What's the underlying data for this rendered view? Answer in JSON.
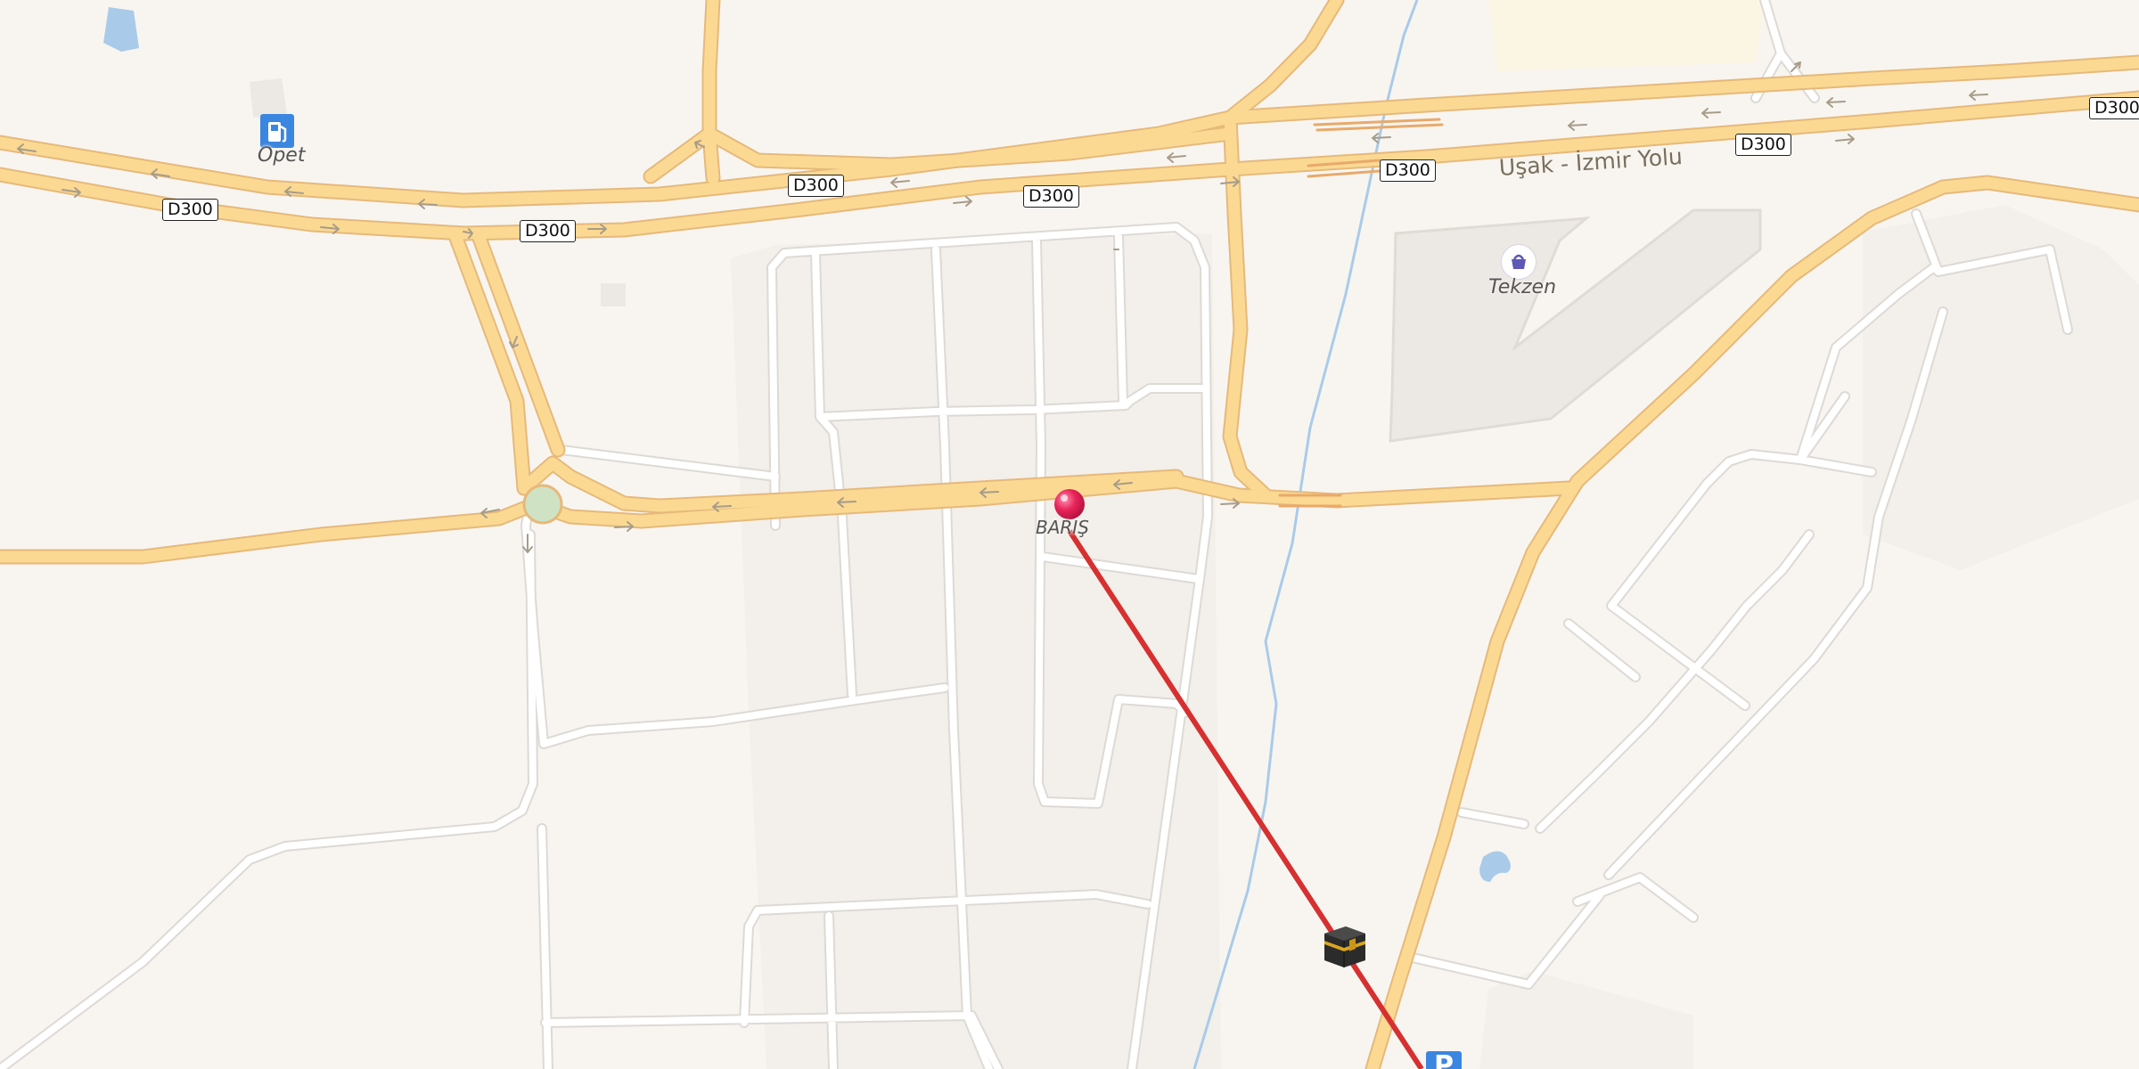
{
  "map": {
    "background_color": "#f8f5f1",
    "road_color": "#fbd993",
    "road_casing_color": "#e6b97a",
    "street_color": "#ffffff",
    "water_color": "#a9cbe9",
    "qibla_line_color": "#d63030"
  },
  "road_shields": [
    {
      "label": "D300"
    },
    {
      "label": "D300"
    },
    {
      "label": "D300"
    },
    {
      "label": "D300"
    },
    {
      "label": "D300"
    },
    {
      "label": "D300"
    },
    {
      "label": "D300"
    }
  ],
  "road_name": "Uşak - İzmir Yolu",
  "places": {
    "fuel_station": {
      "name": "Opet",
      "icon": "fuel-pump-icon"
    },
    "shop": {
      "name": "Tekzen",
      "icon": "shopping-basket-icon"
    },
    "marker": {
      "name": "BARIŞ",
      "icon": "location-pin-icon",
      "color": "#e8245a"
    },
    "kaaba": {
      "icon": "kaaba-icon"
    },
    "parking": {
      "label": "P",
      "icon": "parking-icon"
    }
  }
}
